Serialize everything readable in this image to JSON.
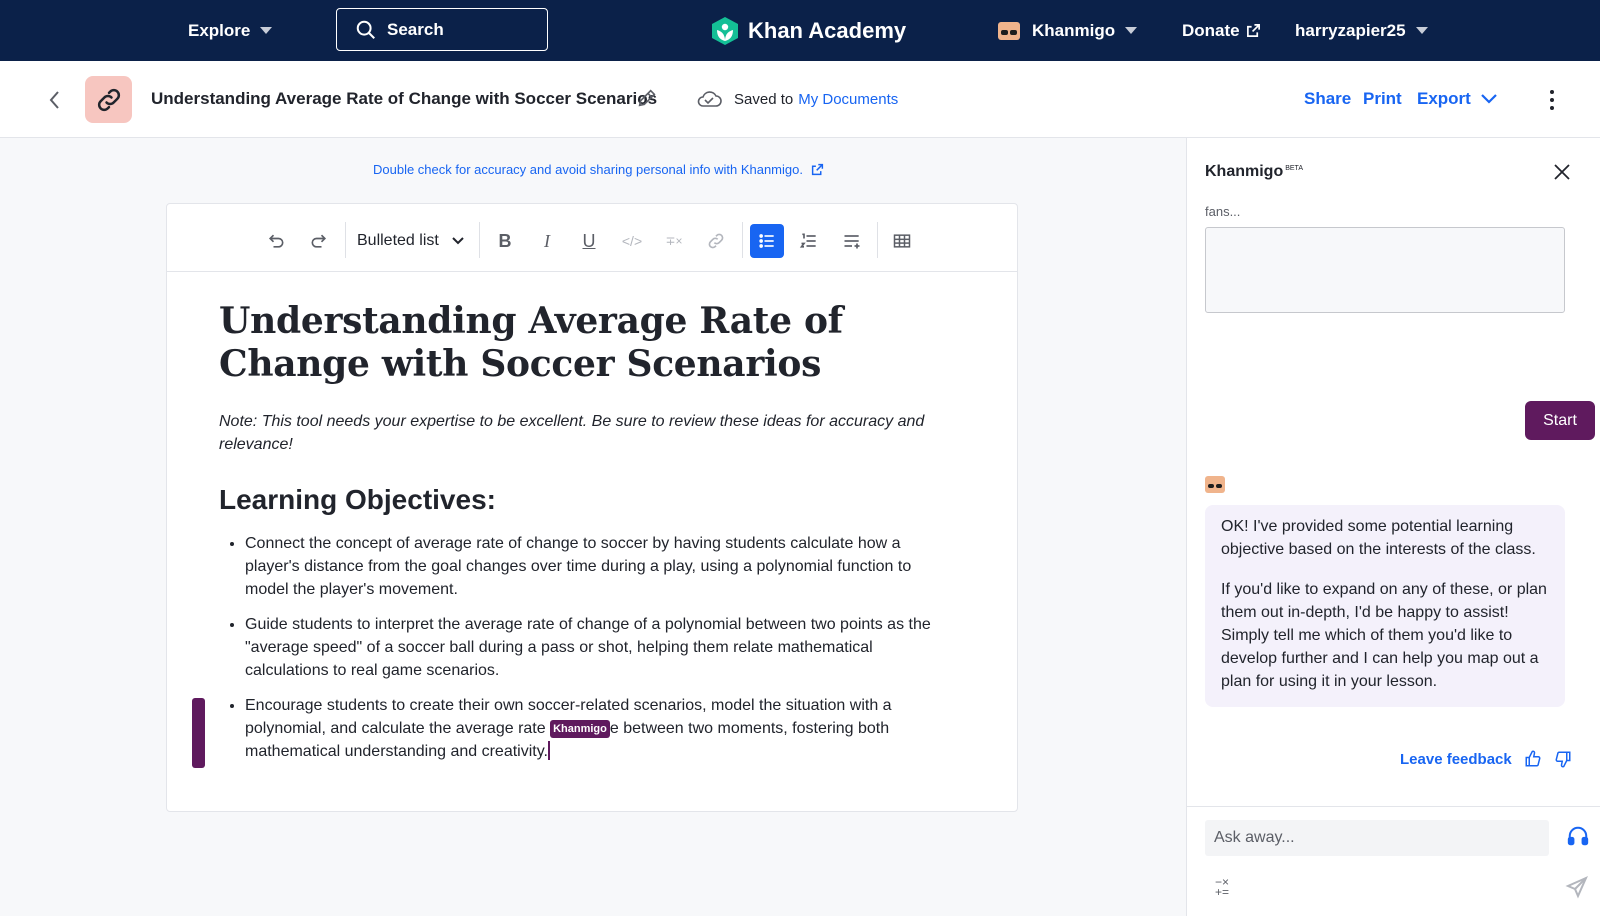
{
  "topnav": {
    "explore": "Explore",
    "search": "Search",
    "logo": "Khan Academy",
    "khanmigo": "Khanmigo",
    "donate": "Donate",
    "username": "harryzapier25"
  },
  "docbar": {
    "title": "Understanding Average Rate of Change with Soccer Scenarios",
    "saved_prefix": "Saved to",
    "saved_link": "My Documents",
    "share": "Share",
    "print": "Print",
    "export": "Export"
  },
  "warning": "Double check for accuracy and avoid sharing personal info with Khanmigo.",
  "toolbar": {
    "block_style": "Bulleted list"
  },
  "document": {
    "heading": "Understanding Average Rate of Change with Soccer Scenarios",
    "note": "Note: This tool needs your expertise to be excellent. Be sure to review these ideas for accuracy and relevance!",
    "section_heading": "Learning Objectives:",
    "objectives": [
      "Connect the concept of average rate of change to soccer by having students calculate how a player's distance from the goal changes over time during a play, using a polynomial function to model the player's movement.",
      "Guide students to interpret the average rate of change of a polynomial between two points as the \"average speed\" of a soccer ball during a pass or shot, helping them relate mathematical calculations to real game scenarios."
    ],
    "objective3_before": "Encourage students to create their own soccer-related scenarios, model the situation with a polynomial, and calculate the average rate ",
    "objective3_badge": "Khanmigo",
    "objective3_after": "e between two moments, fostering both mathematical understanding and creativity."
  },
  "panel": {
    "title": "Khanmigo",
    "beta": "BETA",
    "fans_text": "fans...",
    "start": "Start",
    "message_p1": "OK! I've provided some potential learning objective based on the interests of the class.",
    "message_p2": "If you'd like to expand on any of these, or plan them out in-depth, I'd be happy to assist! Simply tell me which of them you'd like to develop further and I can help you map out a plan for using it in your lesson.",
    "leave_feedback": "Leave feedback",
    "ask_placeholder": "Ask away..."
  }
}
